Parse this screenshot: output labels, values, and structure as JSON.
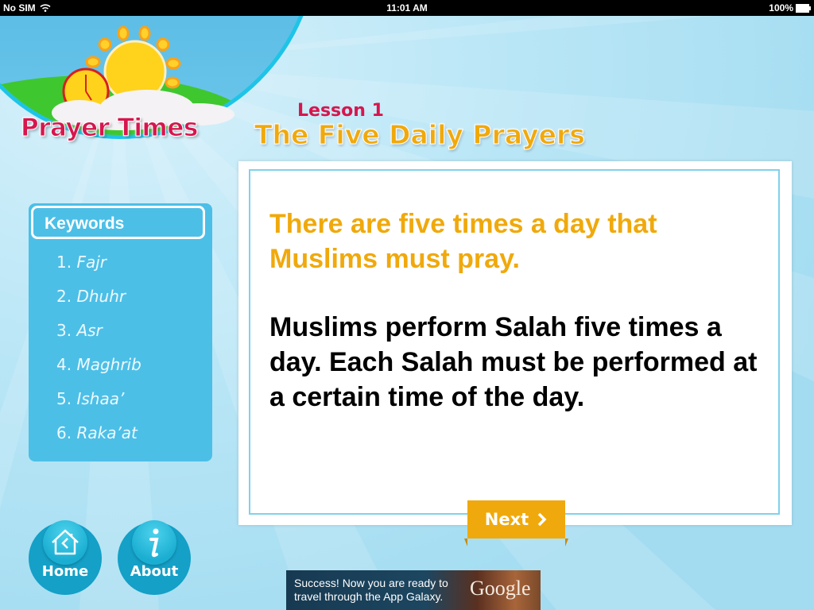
{
  "status_bar": {
    "carrier": "No SIM",
    "time": "11:01 AM",
    "battery": "100%"
  },
  "app": {
    "title": "Prayer Times"
  },
  "lesson": {
    "label": "Lesson 1",
    "title": "The Five Daily Prayers"
  },
  "keywords": {
    "header": "Keywords",
    "items": [
      {
        "number": "1.",
        "term": "Fajr"
      },
      {
        "number": "2.",
        "term": "Dhuhr"
      },
      {
        "number": "3.",
        "term": "Asr"
      },
      {
        "number": "4.",
        "term": "Maghrib"
      },
      {
        "number": "5.",
        "term": "Ishaa’"
      },
      {
        "number": "6.",
        "term": "Raka’at"
      }
    ]
  },
  "content": {
    "lead": "There are five times a day that Muslims must pray.",
    "body": "Muslims perform Salah five times a day. Each Salah must be performed at a certain time of the day."
  },
  "buttons": {
    "next": "Next",
    "home": "Home",
    "about": "About"
  },
  "ad": {
    "text": "Success! Now you are ready to travel through the App Galaxy.",
    "brand": "Google"
  },
  "colors": {
    "accent_orange": "#f0a90c",
    "title_pink": "#d6164d",
    "panel_blue": "#4cbfe7",
    "button_teal": "#14a0c7"
  }
}
